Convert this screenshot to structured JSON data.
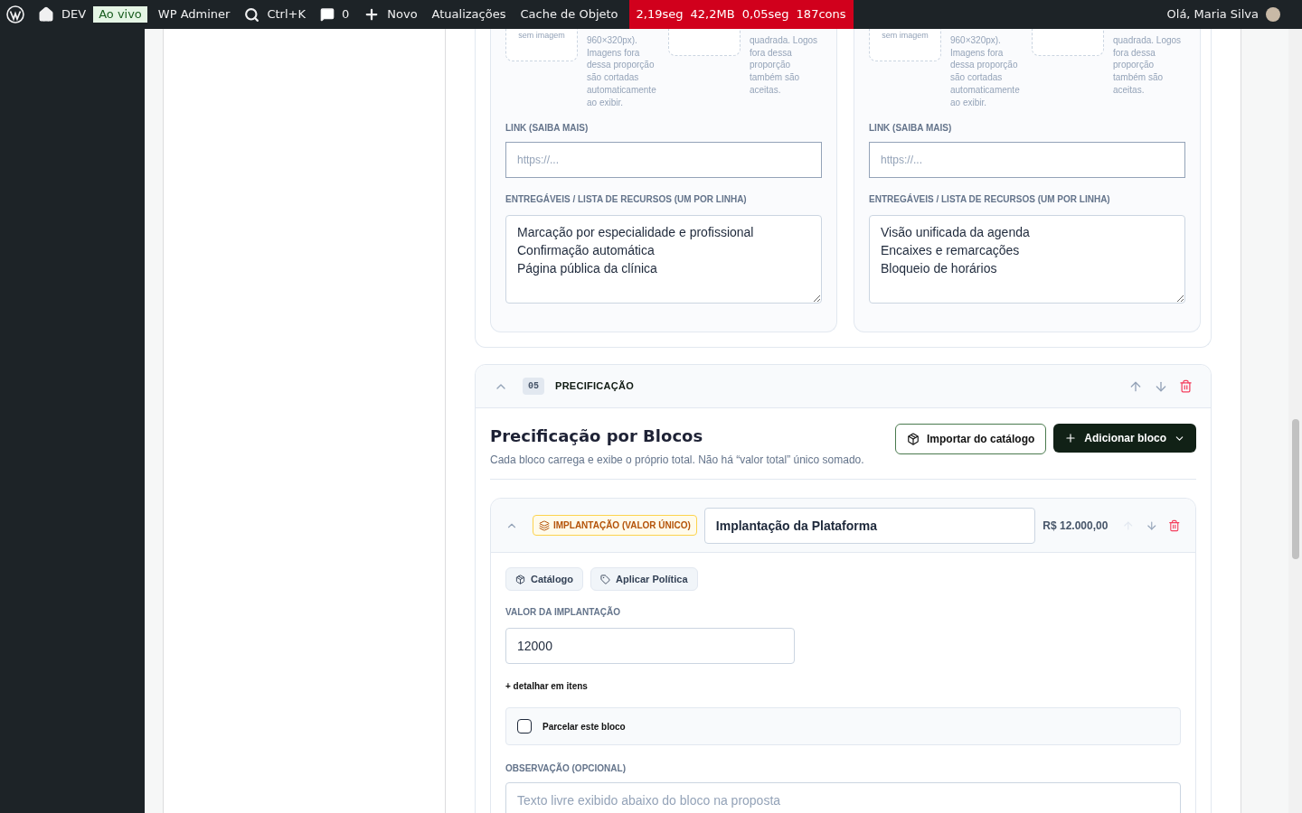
{
  "admin_bar": {
    "site": "DEV",
    "env_badge": "Ao vivo",
    "items": [
      {
        "kind": "text",
        "label": "WP Adminer"
      },
      {
        "kind": "search",
        "label": "Ctrl+K"
      },
      {
        "kind": "comments",
        "label": "0"
      },
      {
        "kind": "new",
        "label": "Novo"
      },
      {
        "kind": "text",
        "label": "Atualizações"
      },
      {
        "kind": "text",
        "label": "Cache de Objeto"
      }
    ],
    "stats": [
      "2,19seg",
      "42,2MB",
      "0,05seg",
      "187cons"
    ],
    "greeting": "Olá, Maria Silva"
  },
  "cards": [
    {
      "thumb_placeholder": "sem imagem",
      "banner_hint": "960×320px). Imagens fora dessa proporção são cortadas automaticamente ao exibir.",
      "logo_hint": "quadrada. Logos fora dessa proporção também são aceitas.",
      "link_label": "LINK (SAIBA MAIS)",
      "link_placeholder": "https://...",
      "list_label": "ENTREGÁVEIS / LISTA DE RECURSOS (UM POR LINHA)",
      "list_value": "Marcação por especialidade e profissional\nConfirmação automática\nPágina pública da clínica"
    },
    {
      "thumb_placeholder": "sem imagem",
      "banner_hint": "960×320px). Imagens fora dessa proporção são cortadas automaticamente ao exibir.",
      "logo_hint": "quadrada. Logos fora dessa proporção também são aceitas.",
      "link_label": "LINK (SAIBA MAIS)",
      "link_placeholder": "https://...",
      "list_label": "ENTREGÁVEIS / LISTA DE RECURSOS (UM POR LINHA)",
      "list_value": "Visão unificada da agenda\nEncaixes e remarcações\nBloqueio de horários"
    }
  ],
  "section": {
    "number": "05",
    "title": "PRECIFICAÇÃO",
    "expanded": true,
    "heading": "Precificação por Blocos",
    "subtitle": "Cada bloco carrega e exibe o próprio total. Não há “valor total” único somado.",
    "import_button": "Importar do catálogo",
    "add_button": "Adicionar bloco",
    "block": {
      "expanded": true,
      "type_badge": "IMPLANTAÇÃO (VALOR ÚNICO)",
      "name": "Implantação da Plataforma",
      "total": "R$ 12.000,00",
      "move_up_disabled": true,
      "chips": [
        "Catálogo",
        "Aplicar Política"
      ],
      "value_label": "VALOR DA IMPLANTAÇÃO",
      "value": "12000",
      "detail_link": "+ detalhar em itens",
      "installments_label": "Parcelar este bloco",
      "installments_checked": false,
      "note_label": "OBSERVAÇÃO (OPCIONAL)",
      "note_placeholder": "Texto livre exibido abaixo do bloco na proposta"
    }
  }
}
